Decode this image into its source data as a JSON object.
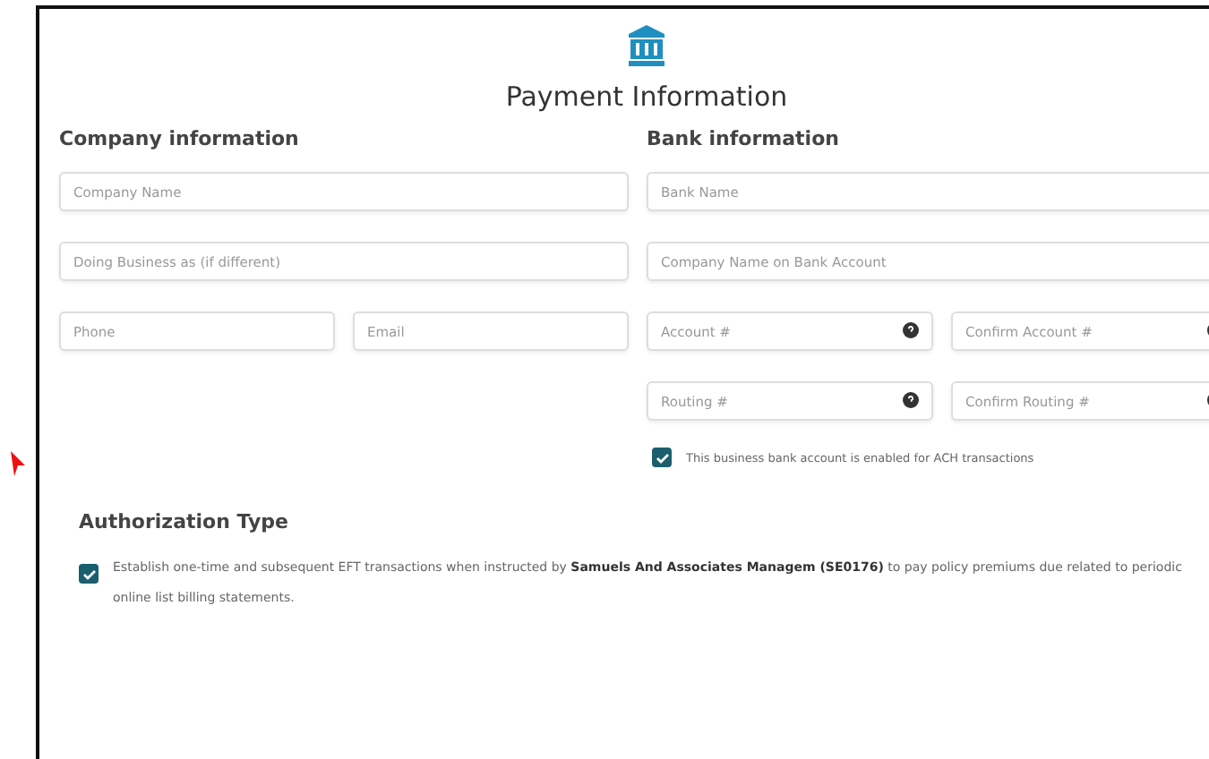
{
  "title": "Payment Information",
  "company": {
    "heading": "Company information",
    "fields": [
      {
        "placeholder": "Company Name"
      },
      {
        "placeholder": "Doing Business as (if different)"
      }
    ],
    "pair": [
      {
        "placeholder": "Phone"
      },
      {
        "placeholder": "Email"
      }
    ]
  },
  "bank": {
    "heading": "Bank information",
    "fields": [
      {
        "placeholder": "Bank Name"
      },
      {
        "placeholder": "Company Name on Bank Account"
      }
    ],
    "pairs": [
      [
        {
          "placeholder": "Account #"
        },
        {
          "placeholder": "Confirm Account #"
        }
      ],
      [
        {
          "placeholder": "Routing #"
        },
        {
          "placeholder": "Confirm Routing #"
        }
      ]
    ],
    "ach": {
      "label": "This business bank account is enabled for ACH transactions",
      "checked": true
    }
  },
  "authorization": {
    "heading": "Authorization Type",
    "option": {
      "text": "Establish one-time and subsequent EFT transactions when instructed by **Samuels And Associates Managem (SE0176)** to pay policy premiums due related to periodic online list billing statements.",
      "checked": true
    }
  }
}
